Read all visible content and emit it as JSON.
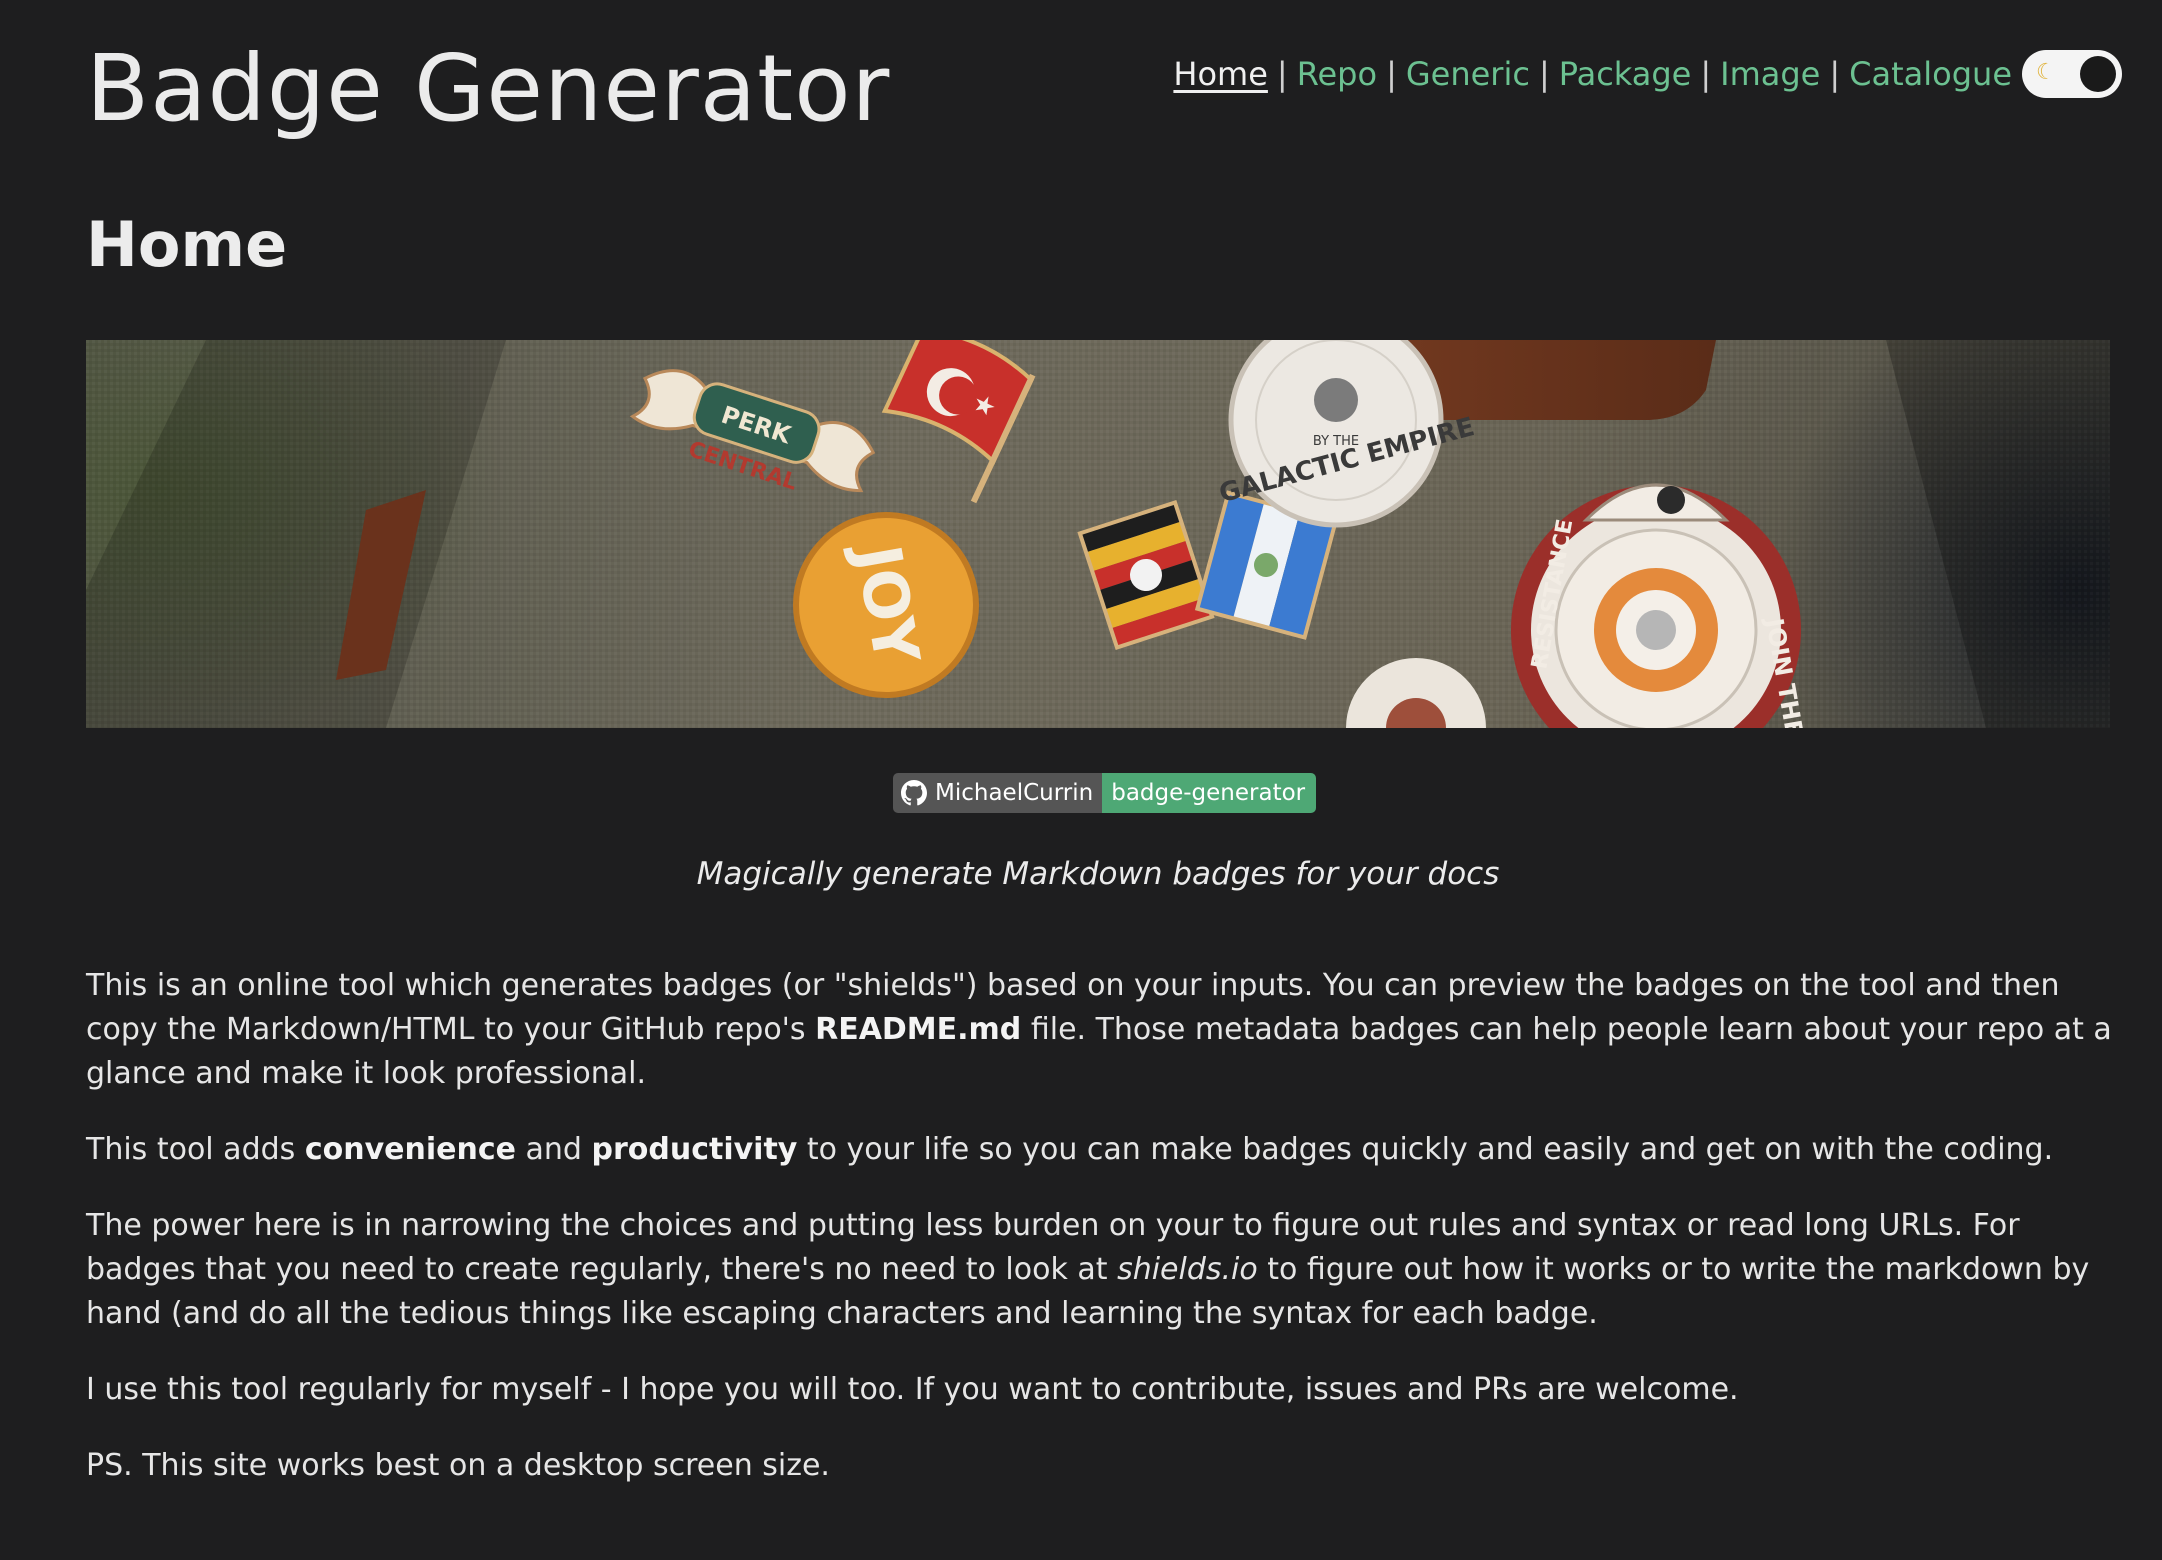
{
  "header": {
    "site_title": "Badge Generator",
    "nav": [
      {
        "label": "Home",
        "current": true
      },
      {
        "label": "Repo",
        "current": false
      },
      {
        "label": "Generic",
        "current": false
      },
      {
        "label": "Package",
        "current": false
      },
      {
        "label": "Image",
        "current": false
      },
      {
        "label": "Catalogue",
        "current": false
      }
    ],
    "separator": "|",
    "theme_toggle": {
      "icon": "moon-icon",
      "mode": "dark"
    }
  },
  "page": {
    "heading": "Home",
    "banner": {
      "pins": [
        "PERK CENTRAL",
        "GALACTIC EMPIRE",
        "BY THE",
        "JOY",
        "JOIN THE RESISTANCE"
      ]
    },
    "repo_badge": {
      "icon": "github-icon",
      "owner": "MichaelCurrin",
      "repo": "badge-generator",
      "left_color": "#555555",
      "right_color": "#4ea875"
    },
    "tagline": "Magically generate Markdown badges for your docs"
  },
  "content": {
    "p1": {
      "text_a": "This is an online tool which generates badges (or \"shields\") based on your inputs. You can preview the badges on the tool and then copy the Markdown/HTML to your GitHub repo's ",
      "bold": "README.md",
      "text_b": " file. Those metadata badges can help people learn about your repo at a glance and make it look professional."
    },
    "p2": {
      "text_a": "This tool adds ",
      "bold_a": "convenience",
      "text_b": " and ",
      "bold_b": "productivity",
      "text_c": " to your life so you can make badges quickly and easily and get on with the coding."
    },
    "p3": {
      "text_a": "The power here is in narrowing the choices and putting less burden on your to figure out rules and syntax or read long URLs. For badges that you need to create regularly, there's no need to look at ",
      "italic": "shields.io",
      "text_b": " to figure out how it works or to write the markdown by hand (and do all the tedious things like escaping characters and learning the syntax for each badge."
    },
    "p4": "I use this tool regularly for myself - I hope you will too. If you want to contribute, issues and PRs are welcome.",
    "p5": "PS. This site works best on a desktop screen size."
  },
  "colors": {
    "background": "#1e1e1f",
    "link": "#6cc191",
    "text": "#e6e6e6"
  }
}
